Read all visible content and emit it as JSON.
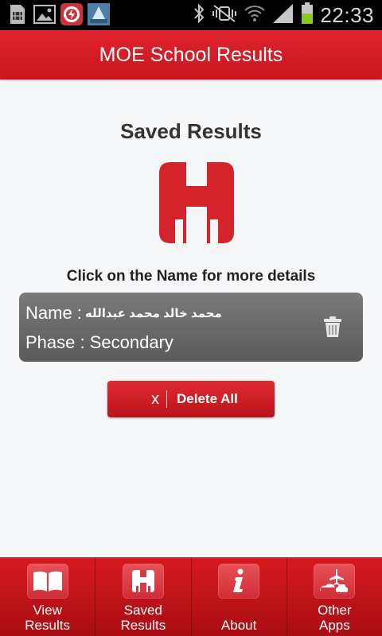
{
  "status_bar": {
    "time": "22:33"
  },
  "app_bar": {
    "title": "MOE School Results"
  },
  "page": {
    "title": "Saved Results",
    "hint": "Click on the Name for more details"
  },
  "saved_results": [
    {
      "name_label": "Name :",
      "name_value": "محمد خالد محمد عبدالله",
      "phase_label": "Phase :",
      "phase_value": "Secondary"
    }
  ],
  "delete_all": {
    "icon": "x",
    "label": "Delete All"
  },
  "bottom_nav": {
    "items": [
      {
        "line1": "View",
        "line2": "Results",
        "icon": "book-icon"
      },
      {
        "line1": "Saved",
        "line2": "Results",
        "icon": "saved-logo-icon"
      },
      {
        "line1": "",
        "line2": "About",
        "icon": "info-icon"
      },
      {
        "line1": "Other",
        "line2": "Apps",
        "icon": "travel-icon"
      }
    ]
  },
  "colors": {
    "brand_red": "#d7191f",
    "card_gray": "#6a6a6a",
    "background": "#f4f6f8"
  }
}
